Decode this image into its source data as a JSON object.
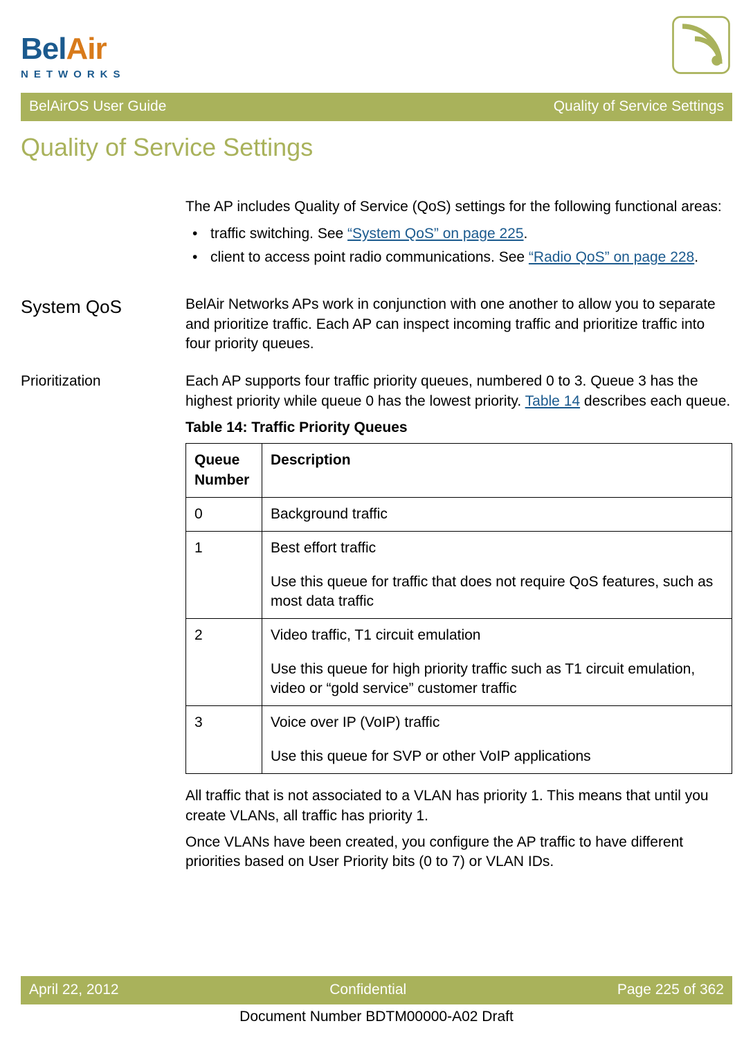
{
  "logo": {
    "brand_part1": "Bel",
    "brand_part2": "Air",
    "sub": "NETWORKS"
  },
  "header": {
    "left": "BelAirOS User Guide",
    "right": "Quality of Service Settings"
  },
  "page_title": "Quality of Service Settings",
  "intro": "The AP includes Quality of Service (QoS) settings for the following functional areas:",
  "bullets": {
    "b1_pre": "traffic switching. See ",
    "b1_link": "“System QoS” on page 225",
    "b1_post": ".",
    "b2_pre": "client to access point radio communications. See ",
    "b2_link": "“Radio QoS” on page 228",
    "b2_post": "."
  },
  "sections": {
    "system_qos": {
      "heading": "System QoS",
      "text": "BelAir Networks APs work in conjunction with one another to allow you to separate and prioritize traffic. Each AP can inspect incoming traffic and prioritize traffic into four priority queues."
    },
    "prioritization": {
      "heading": "Prioritization",
      "text_pre": "Each AP supports four traffic priority queues, numbered 0 to 3. Queue 3 has the highest priority while queue 0 has the lowest priority. ",
      "link": "Table 14",
      "text_post": " describes each queue."
    }
  },
  "table": {
    "caption": "Table 14: Traffic Priority Queues",
    "head_col1": "Queue Number",
    "head_col2": "Description",
    "rows": [
      {
        "num": "0",
        "desc": "Background traffic",
        "sub": ""
      },
      {
        "num": "1",
        "desc": "Best effort traffic",
        "sub": "Use this queue for traffic that does not require QoS features, such as most data traffic"
      },
      {
        "num": "2",
        "desc": "Video traffic, T1 circuit emulation",
        "sub": "Use this queue for high priority traffic such as T1 circuit emulation, video or “gold service” customer traffic"
      },
      {
        "num": "3",
        "desc": "Voice over IP (VoIP) traffic",
        "sub": "Use this queue for SVP or other VoIP applications"
      }
    ]
  },
  "after_table": {
    "p1": "All traffic that is not associated to a VLAN has priority 1. This means that until you create VLANs, all traffic has priority 1.",
    "p2": "Once VLANs have been created, you configure the AP traffic to have different priorities based on User Priority bits (0 to 7) or VLAN IDs."
  },
  "footer": {
    "date": "April 22, 2012",
    "center": "Confidential",
    "page": "Page 225 of 362",
    "docnum": "Document Number BDTM00000-A02 Draft"
  }
}
